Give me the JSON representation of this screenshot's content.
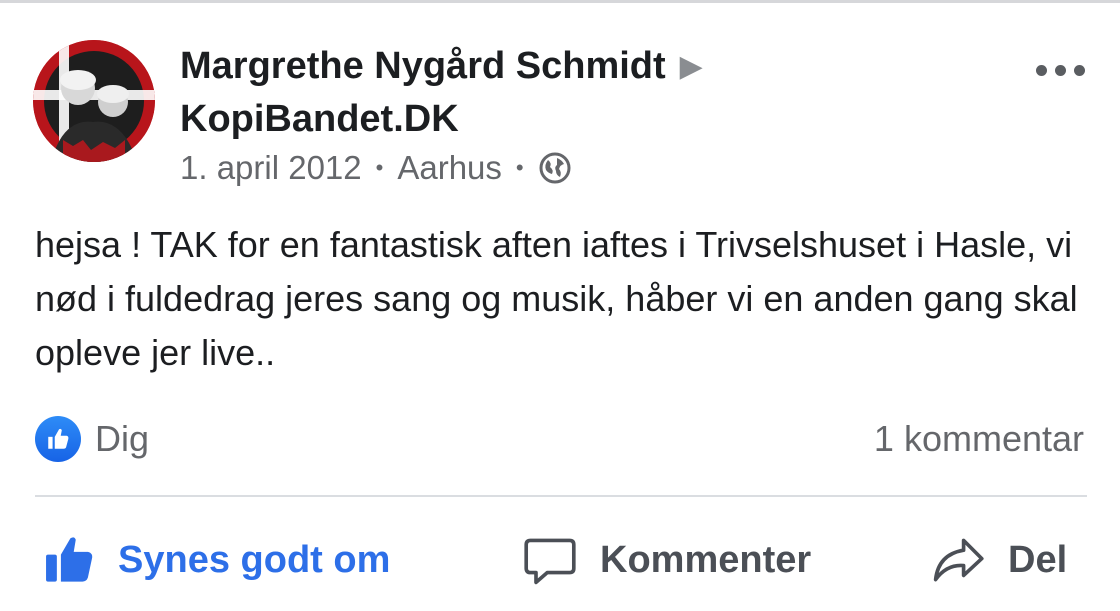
{
  "post": {
    "author": "Margrethe Nygård Schmidt",
    "target": "KopiBandet.DK",
    "date": "1. april 2012",
    "location": "Aarhus",
    "privacy_icon": "globe-icon",
    "more_icon": "more-options-icon",
    "text": "hejsa ! TAK for en fantastisk aften iaftes i Trivselshuset i Hasle, vi nød i fuldedrag jeres sang og musik, håber vi en anden gang skal opleve jer live.."
  },
  "reactions": {
    "likes_label": "Dig",
    "comments_label": "1 kommentar"
  },
  "actions": {
    "like": "Synes godt om",
    "comment": "Kommenter",
    "share": "Del"
  },
  "colors": {
    "accent": "#2d6fe8",
    "text": "#1c1e21",
    "secondary": "#65676b",
    "avatar_ring": "#b8151b"
  }
}
